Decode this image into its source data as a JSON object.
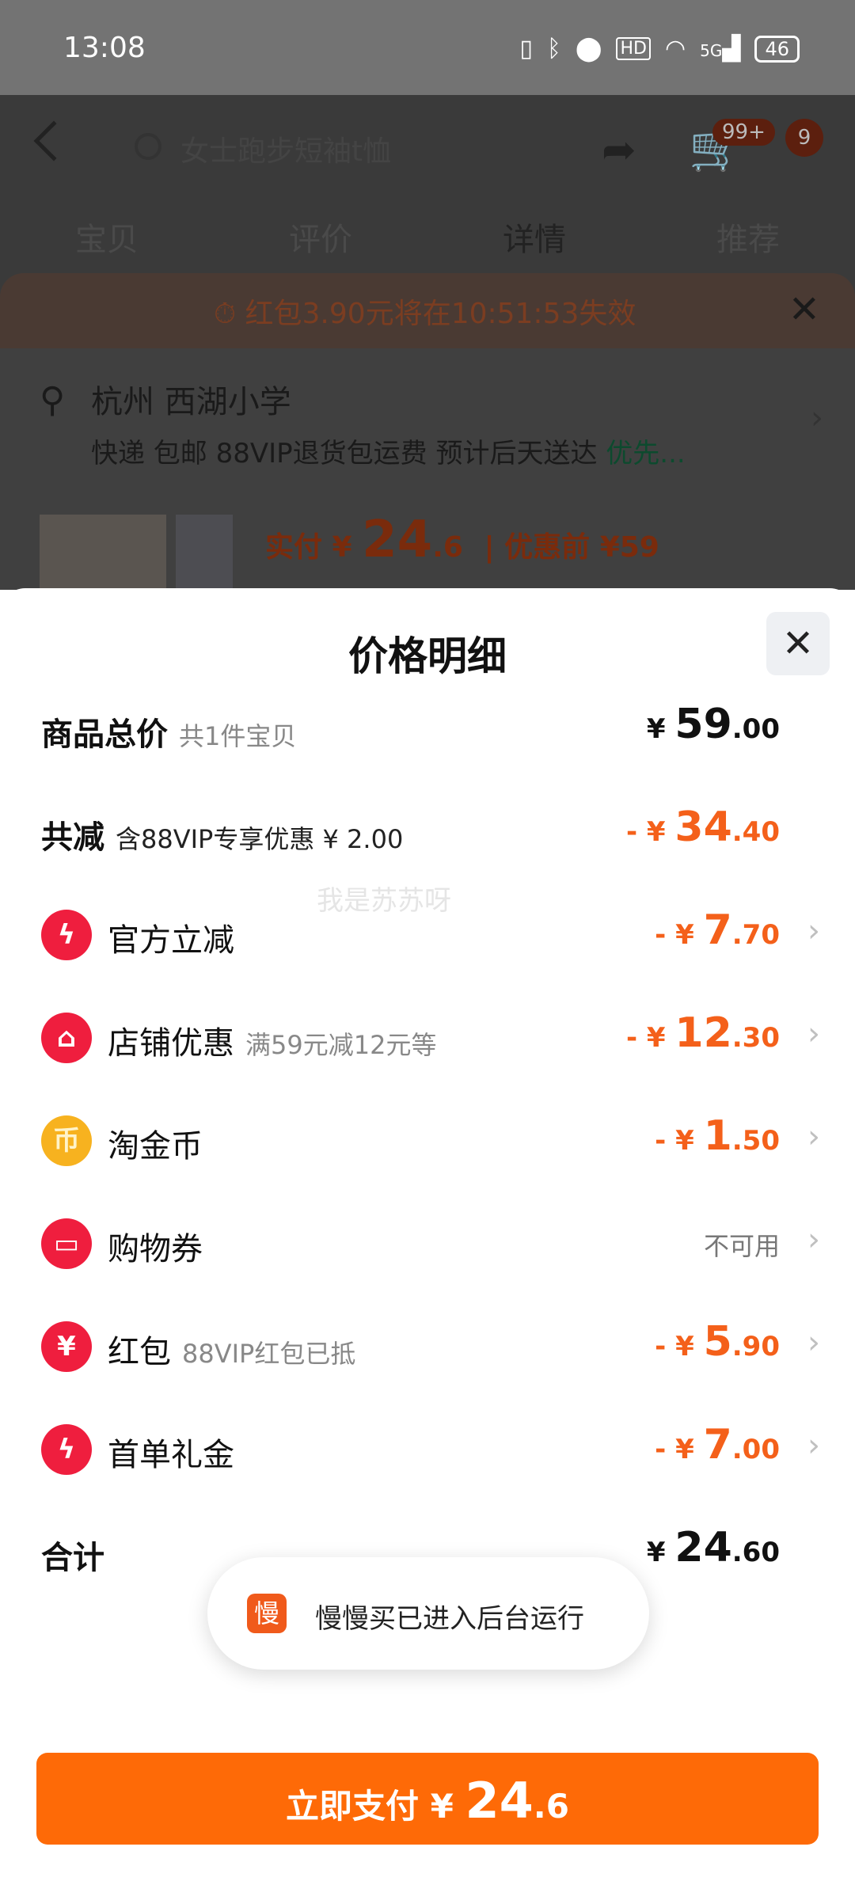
{
  "status_bar": {
    "time": "13:08",
    "battery": "46",
    "network": "5G",
    "icons": [
      "vibrate-icon",
      "bluetooth-icon",
      "location-icon",
      "hd-icon",
      "wifi-icon",
      "signal-icon",
      "battery-icon"
    ]
  },
  "background_page": {
    "search_placeholder": "女士跑步短袖t恤",
    "cart_badge": "99+",
    "message_badge": "9",
    "tabs": [
      "宝贝",
      "评价",
      "详情",
      "推荐"
    ],
    "active_tab": "详情",
    "red_packet_timer": "红包3.90元将在10:51:53失效",
    "address_title": "杭州 西湖小学",
    "delivery_text": "快递 包邮 88VIP退货包运费 预计后天送达",
    "delivery_extra": "优先...",
    "paid_prefix": "实付 ¥",
    "paid_int": "24",
    "paid_dec": ".6",
    "before_discount": "| 优惠前 ¥59"
  },
  "sheet": {
    "title": "价格明细",
    "rows": [
      {
        "label": "商品总价",
        "sub": "共1件宝贝",
        "currency": "¥",
        "int": "59",
        "dec": ".00"
      },
      {
        "label": "共减",
        "sub": "含88VIP专享优惠 ¥ 2.00",
        "sign": "- ¥",
        "int": "34",
        "dec": ".40"
      },
      {
        "label": "官方立减",
        "sign": "- ¥",
        "int": "7",
        "dec": ".70"
      },
      {
        "label": "店铺优惠",
        "sub": "满59元减12元等",
        "sign": "- ¥",
        "int": "12",
        "dec": ".30"
      },
      {
        "label": "淘金币",
        "sign": "- ¥",
        "int": "1",
        "dec": ".50"
      },
      {
        "label": "购物券",
        "status": "不可用"
      },
      {
        "label": "红包",
        "sub": "88VIP红包已抵",
        "sign": "- ¥",
        "int": "5",
        "dec": ".90"
      },
      {
        "label": "首单礼金",
        "sign": "- ¥",
        "int": "7",
        "dec": ".00"
      },
      {
        "label": "合计",
        "currency": "¥",
        "int": "24",
        "dec": ".60"
      }
    ],
    "watermark": "我是苏苏呀"
  },
  "toast": {
    "icon_char": "慢",
    "text": "慢慢买已进入后台运行"
  },
  "pay_button": {
    "prefix": "立即支付 ¥",
    "int": "24",
    "dec": ".6"
  },
  "colors": {
    "accent": "#fe6a07",
    "discount": "#f4601a",
    "icon_red": "#ef1e3e",
    "icon_gold": "#f7b21f"
  }
}
